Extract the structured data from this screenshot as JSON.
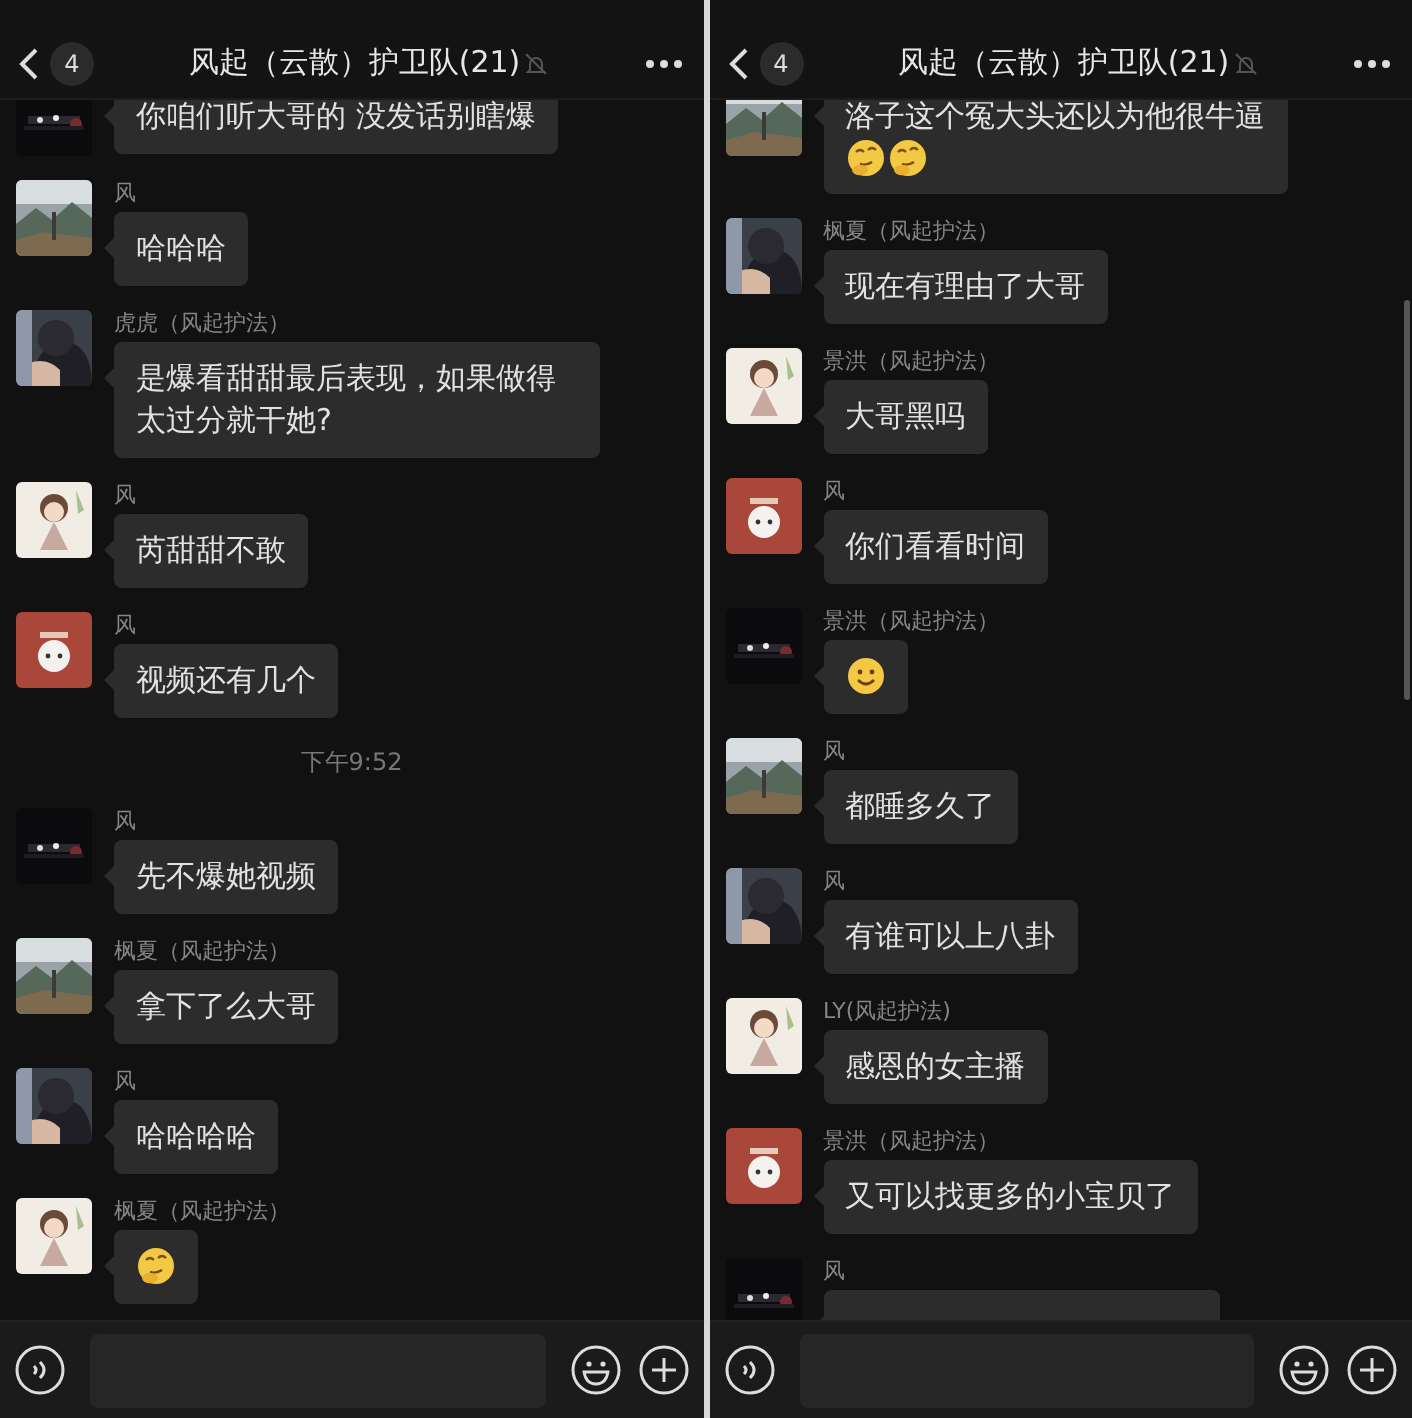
{
  "panels": [
    {
      "header": {
        "back_count": "4",
        "title": "风起（云散）护卫队(21)",
        "muted": true
      },
      "scrollbar": false,
      "messages": [
        {
          "kind": "text",
          "text": "你咱们听大哥的 没发话别瞎爆"
        },
        {
          "kind": "text",
          "sender": "风",
          "text": "哈哈哈"
        },
        {
          "kind": "text",
          "sender": "虎虎（风起护法）",
          "text": "是爆看甜甜最后表现，如果做得太过分就干她?"
        },
        {
          "kind": "text",
          "sender": "风",
          "text": "芮甜甜不敢"
        },
        {
          "kind": "text",
          "sender": "风",
          "text": "视频还有几个"
        },
        {
          "kind": "time",
          "text": "下午9:52"
        },
        {
          "kind": "text",
          "sender": "风",
          "text": "先不爆她视频"
        },
        {
          "kind": "text",
          "sender": "枫夏（风起护法）",
          "text": "拿下了么大哥"
        },
        {
          "kind": "text",
          "sender": "风",
          "text": "哈哈哈哈"
        },
        {
          "kind": "emoji",
          "sender": "枫夏（风起护法）",
          "stickers": [
            {
              "kind": "thinking"
            }
          ]
        }
      ]
    },
    {
      "header": {
        "back_count": "4",
        "title": "风起（云散）护卫队(21)",
        "muted": true
      },
      "scrollbar": true,
      "messages": [
        {
          "kind": "text",
          "text": "洛子这个冤大头还以为他很牛逼",
          "stickers": [
            {
              "kind": "thinking"
            },
            {
              "kind": "thinking"
            }
          ]
        },
        {
          "kind": "text",
          "sender": "枫夏（风起护法）",
          "text": "现在有理由了大哥"
        },
        {
          "kind": "text",
          "sender": "景洪（风起护法）",
          "text": "大哥黑吗"
        },
        {
          "kind": "text",
          "sender": "风",
          "text": "你们看看时间"
        },
        {
          "kind": "emoji",
          "sender": "景洪（风起护法）",
          "stickers": [
            {
              "kind": "smile"
            }
          ]
        },
        {
          "kind": "text",
          "sender": "风",
          "text": "都睡多久了"
        },
        {
          "kind": "text",
          "sender": "风",
          "text": "有谁可以上八卦"
        },
        {
          "kind": "text",
          "sender": "LY(风起护法)",
          "text": "感恩的女主播"
        },
        {
          "kind": "text",
          "sender": "景洪（风起护法）",
          "text": "又可以找更多的小宝贝了"
        },
        {
          "kind": "text",
          "sender": "风"
        }
      ]
    }
  ]
}
